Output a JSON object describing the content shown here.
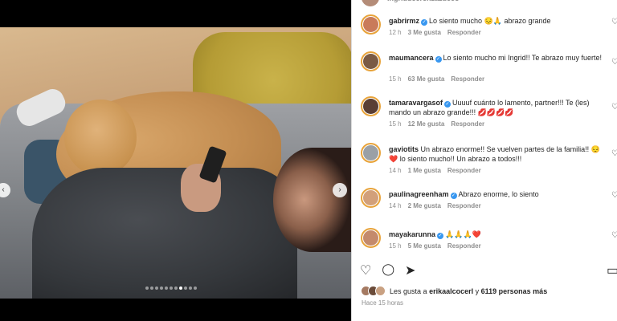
{
  "post_header": {
    "username": "ingriddecrenzazucco"
  },
  "media": {
    "carousel_total": 11,
    "carousel_active_index": 7
  },
  "icons": {
    "nav_prev": "‹",
    "nav_next": "›",
    "like": "♡",
    "comment": "💬",
    "share": "➤",
    "bookmark": "🔖",
    "comment_like": "♡",
    "verified": "✓"
  },
  "comments": [
    {
      "username": "gabrirmz",
      "verified": true,
      "text": "Lo siento mucho 😔🙏 abrazo grande",
      "time": "12 h",
      "likes": "3 Me gusta",
      "reply": "Responder",
      "avatar_color": "#c97b5a"
    },
    {
      "username": "maumancera",
      "verified": true,
      "text": "Lo siento mucho mi Ingrid!! Te abrazo muy fuerte!",
      "time": "15 h",
      "likes": "63 Me gusta",
      "reply": "Responder",
      "avatar_color": "#7a5a44"
    },
    {
      "username": "tamaravargasof",
      "verified": true,
      "text": "Uuuuf cuánto lo lamento, partner!!! Te (les) mando un abrazo grande!!! 💋💋💋💋",
      "time": "15 h",
      "likes": "12 Me gusta",
      "reply": "Responder",
      "avatar_color": "#5a3e34"
    },
    {
      "username": "gaviotits",
      "verified": false,
      "text": "Un abrazo enorme!! Se vuelven partes de la familia!! 😔❤️ lo siento mucho!! Un abrazo a todos!!!",
      "time": "14 h",
      "likes": "1 Me gusta",
      "reply": "Responder",
      "avatar_color": "#9aa0a6"
    },
    {
      "username": "paulinagreenham",
      "verified": true,
      "text": "Abrazo enorme, lo siento",
      "time": "14 h",
      "likes": "2 Me gusta",
      "reply": "Responder",
      "avatar_color": "#d2a07a"
    },
    {
      "username": "mayakarunna",
      "verified": true,
      "text": "🙏🙏🙏❤️",
      "time": "15 h",
      "likes": "5 Me gusta",
      "reply": "Responder",
      "avatar_color": "#c48a6c"
    }
  ],
  "likes_summary": {
    "prefix": "Les gusta a",
    "user": "erikaalcocerl",
    "connector": "y",
    "others": "6119 personas más",
    "avatar_colors": [
      "#a57a62",
      "#6b4c3a",
      "#c9a182"
    ]
  },
  "post_time": "Hace 15 horas"
}
